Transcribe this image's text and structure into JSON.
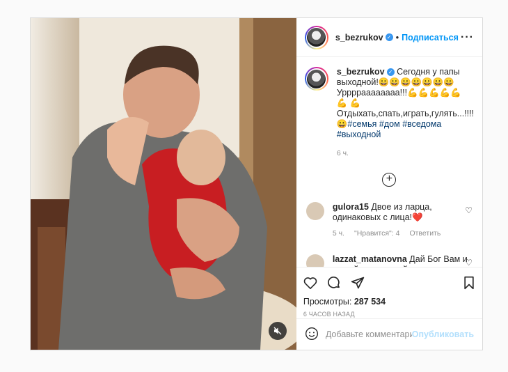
{
  "post": {
    "username": "s_bezrukov",
    "follow_label": "Подписаться",
    "dot": "•",
    "more_icon": "more-icon",
    "caption": {
      "username": "s_bezrukov",
      "line1": "Сегодня у папы выходной!",
      "emoji1": "😀😀😀😀😀😀😀",
      "line2": "Урррраааааааа!!!",
      "emoji2": "💪💪💪💪💪💪",
      "line3": "💪Отдыхать,спать,играть,гулять...!!!!",
      "emoji3": "😀",
      "tags": [
        "#семья",
        "#дом",
        "#вседома",
        "#выходной"
      ]
    },
    "caption_time": "6 ч."
  },
  "comments": [
    {
      "username": "gulora15",
      "text": "Двое из ларца, одинаковых с лица!",
      "emoji": "❤️",
      "time": "5 ч.",
      "likes": "\"Нравится\": 4",
      "reply": "Ответить"
    },
    {
      "username": "lazzat_matanovna",
      "text": "Дай Бог Вам и вашей прекрасной семье большого счастья и всегда"
    }
  ],
  "actions": {
    "views_label": "Просмотры:",
    "views_count": "287 534",
    "ago": "6 ЧАСОВ НАЗАД"
  },
  "add_comment": {
    "placeholder": "Добавьте комментарий...",
    "publish": "Опубликовать"
  },
  "colors": {
    "accent": "#0095f6",
    "verified": "#3897f0",
    "heart": "#ed4956"
  }
}
